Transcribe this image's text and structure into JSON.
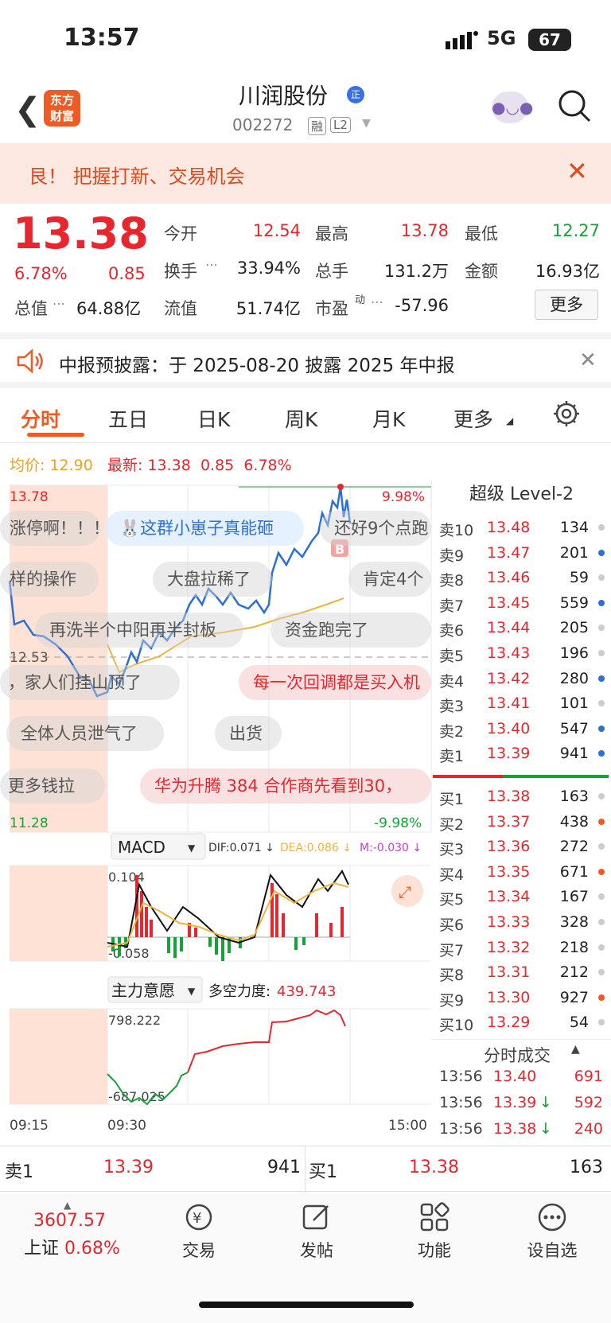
{
  "status": {
    "time": "13:57",
    "network": "5G",
    "battery": "67"
  },
  "header": {
    "title": "川润股份",
    "badge": "正",
    "code": "002272",
    "tag1": "融",
    "tag2": "L2",
    "logo_line1": "东方",
    "logo_line2": "财富"
  },
  "banner": {
    "text": "艮！ 把握打新、交易机会"
  },
  "quote": {
    "price": "13.38",
    "pct": "6.78%",
    "change": "0.85",
    "mv_label": "总值",
    "mv_value": "64.88亿",
    "open_label": "今开",
    "open": "12.54",
    "high_label": "最高",
    "high": "13.78",
    "low_label": "最低",
    "low": "12.27",
    "turnover_label": "换手",
    "turnover": "33.94%",
    "volume_label": "总手",
    "volume": "131.2万",
    "amount_label": "金额",
    "amount": "16.93亿",
    "float_label": "流值",
    "float": "51.74亿",
    "pe_label": "市盈",
    "pe_sup": "动",
    "pe": "-57.96",
    "more": "更多"
  },
  "notice": {
    "text": "中报预披露：于 2025-08-20 披露 2025 年中报"
  },
  "tabs": [
    "分时",
    "五日",
    "日K",
    "周K",
    "月K",
    "更多"
  ],
  "avg_row": {
    "avg_label": "均价:",
    "avg": "12.90",
    "latest_label": "最新:",
    "latest": "13.38",
    "chg": "0.85",
    "pct": "6.78%"
  },
  "chart": {
    "top_price": "13.78",
    "top_pct": "9.98%",
    "bottom_price": "11.28",
    "bottom_pct": "-9.98%",
    "mid_price": "12.53",
    "macd_label": "MACD",
    "dif": "DIF:0.071 ↓",
    "dea": "DEA:0.086 ↓",
    "m": "M:-0.030 ↓",
    "macd_max": "0.104",
    "macd_min": "-0.058",
    "force_label": "主力意愿",
    "force_text": "多空力度:",
    "force_value": "439.743",
    "force_max": "798.222",
    "force_min": "-687.025",
    "time_start": "09:15",
    "time_open": "09:30",
    "time_end": "15:00",
    "marker_b": "B",
    "colors": {
      "price_line": "#2b6fd8",
      "avg_line": "#f0b43a",
      "up": "#e8262d",
      "down": "#14a336",
      "premarket": "#fde2d5"
    }
  },
  "danmu": [
    "涨停啊！！！",
    "这群小崽子真能砸",
    "还好9个点跑",
    "样的操作",
    "大盘拉稀了",
    "肯定4个",
    "再洗半个中阳再半封板",
    "资金跑完了",
    "，家人们挂山顶了",
    "每一次回调都是买入机",
    "全体人员泄气了",
    "出货",
    "更多钱拉",
    "华为升腾 384 合作商先看到30，"
  ],
  "level2": {
    "title": "超级 Level-2",
    "asks": [
      {
        "label": "卖10",
        "price": "13.48",
        "vol": "134",
        "dot": "#cccccc"
      },
      {
        "label": "卖9",
        "price": "13.47",
        "vol": "201",
        "dot": "#2b6fd8"
      },
      {
        "label": "卖8",
        "price": "13.46",
        "vol": "59",
        "dot": "#cccccc"
      },
      {
        "label": "卖7",
        "price": "13.45",
        "vol": "559",
        "dot": "#2b6fd8"
      },
      {
        "label": "卖6",
        "price": "13.44",
        "vol": "205",
        "dot": "#cccccc"
      },
      {
        "label": "卖5",
        "price": "13.43",
        "vol": "196",
        "dot": "#cccccc"
      },
      {
        "label": "卖4",
        "price": "13.42",
        "vol": "280",
        "dot": "#2b6fd8"
      },
      {
        "label": "卖3",
        "price": "13.41",
        "vol": "101",
        "dot": "#cccccc"
      },
      {
        "label": "卖2",
        "price": "13.40",
        "vol": "547",
        "dot": "#2b6fd8"
      },
      {
        "label": "卖1",
        "price": "13.39",
        "vol": "941",
        "dot": "#2b6fd8"
      }
    ],
    "bids": [
      {
        "label": "买1",
        "price": "13.38",
        "vol": "163",
        "dot": "#cccccc"
      },
      {
        "label": "买2",
        "price": "13.37",
        "vol": "438",
        "dot": "#f05a24"
      },
      {
        "label": "买3",
        "price": "13.36",
        "vol": "272",
        "dot": "#cccccc"
      },
      {
        "label": "买4",
        "price": "13.35",
        "vol": "671",
        "dot": "#f05a24"
      },
      {
        "label": "买5",
        "price": "13.34",
        "vol": "167",
        "dot": "#cccccc"
      },
      {
        "label": "买6",
        "price": "13.33",
        "vol": "328",
        "dot": "#cccccc"
      },
      {
        "label": "买7",
        "price": "13.32",
        "vol": "218",
        "dot": "#cccccc"
      },
      {
        "label": "买8",
        "price": "13.31",
        "vol": "212",
        "dot": "#cccccc"
      },
      {
        "label": "买9",
        "price": "13.30",
        "vol": "927",
        "dot": "#f05a24"
      },
      {
        "label": "买10",
        "price": "13.29",
        "vol": "54",
        "dot": "#cccccc"
      }
    ],
    "trades_title": "分时成交",
    "trades": [
      {
        "time": "13:56",
        "price": "13.40",
        "arrow": "",
        "vol": "691"
      },
      {
        "time": "13:56",
        "price": "13.39",
        "arrow": "↓",
        "vol": "592"
      },
      {
        "time": "13:56",
        "price": "13.38",
        "arrow": "↓",
        "vol": "240"
      }
    ]
  },
  "bottom_strip": {
    "ask_label": "卖1",
    "ask_price": "13.39",
    "ask_vol": "941",
    "bid_label": "买1",
    "bid_price": "13.38",
    "bid_vol": "163"
  },
  "nav": {
    "index_value": "3607.57",
    "index_name": "上证",
    "index_pct": "0.68%",
    "items": [
      "交易",
      "发帖",
      "功能",
      "设自选"
    ]
  }
}
